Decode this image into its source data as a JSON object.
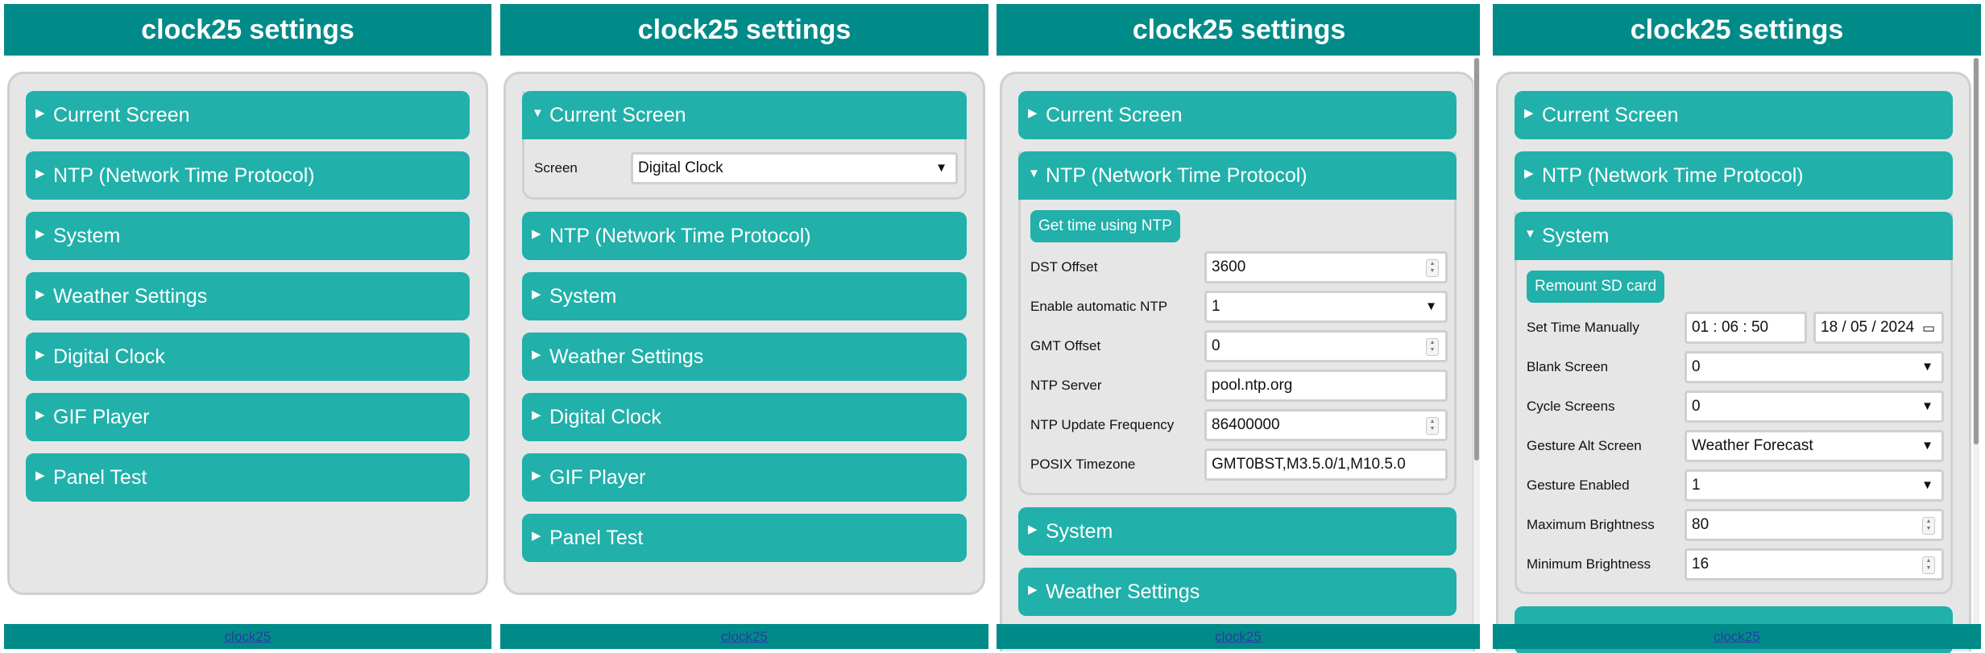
{
  "app": {
    "title": "clock25 settings",
    "footer_link": "clock25"
  },
  "sections": {
    "current_screen": "Current Screen",
    "ntp": "NTP (Network Time Protocol)",
    "system": "System",
    "weather": "Weather Settings",
    "digital_clock": "Digital Clock",
    "gif_player": "GIF Player",
    "panel_test": "Panel Test"
  },
  "icons": {
    "collapsed": "▶",
    "expanded": "▼",
    "dropdown": "▼",
    "calendar": "📅"
  },
  "colors": {
    "header": "#008b88",
    "section": "#21b0aa",
    "box": "#e6e6e6",
    "link": "#2a3aa8"
  },
  "current_screen_form": {
    "screen_label": "Screen",
    "screen_value": "Digital Clock"
  },
  "ntp_form": {
    "button": "Get time using NTP",
    "dst_offset_label": "DST Offset",
    "dst_offset_value": "3600",
    "auto_ntp_label": "Enable automatic NTP",
    "auto_ntp_value": "1",
    "gmt_offset_label": "GMT Offset",
    "gmt_offset_value": "0",
    "server_label": "NTP Server",
    "server_value": "pool.ntp.org",
    "frequency_label": "NTP Update Frequency",
    "frequency_value": "86400000",
    "posix_label": "POSIX Timezone",
    "posix_value": "GMT0BST,M3.5.0/1,M10.5.0"
  },
  "system_form": {
    "button": "Remount SD card",
    "set_time_label": "Set Time Manually",
    "time_value": "01 : 06 : 50",
    "date_value": "18 / 05 / 2024",
    "blank_label": "Blank Screen",
    "blank_value": "0",
    "cycle_label": "Cycle Screens",
    "cycle_value": "0",
    "gesture_alt_label": "Gesture Alt Screen",
    "gesture_alt_value": "Weather Forecast",
    "gesture_enabled_label": "Gesture Enabled",
    "gesture_enabled_value": "1",
    "max_brightness_label": "Maximum Brightness",
    "max_brightness_value": "80",
    "min_brightness_label": "Minimum Brightness",
    "min_brightness_value": "16"
  }
}
